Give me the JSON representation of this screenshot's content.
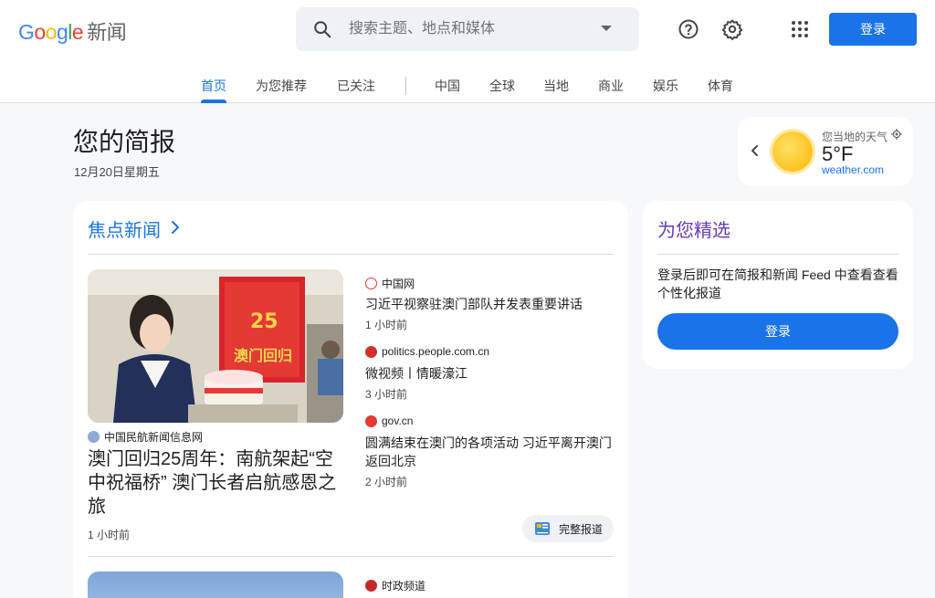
{
  "header": {
    "logo_google": [
      "G",
      "o",
      "o",
      "g",
      "l",
      "e"
    ],
    "logo_news": "新闻",
    "search_placeholder": "搜索主题、地点和媒体",
    "login_label": "登录"
  },
  "tabs": [
    {
      "label": "首页",
      "active": true
    },
    {
      "label": "为您推荐"
    },
    {
      "label": "已关注"
    },
    {
      "label": "中国"
    },
    {
      "label": "全球"
    },
    {
      "label": "当地"
    },
    {
      "label": "商业"
    },
    {
      "label": "娱乐"
    },
    {
      "label": "体育"
    }
  ],
  "briefing": {
    "title": "您的简报",
    "date": "12月20日星期五"
  },
  "weather": {
    "location_label": "您当地的天气",
    "temperature": "5°F",
    "source": "weather.com"
  },
  "top_stories": {
    "title": "焦点新闻",
    "hero": {
      "source": "中国民航新闻信息网",
      "title": "澳门回归25周年：南航架起“空中祝福桥” 澳门长者启航感恩之旅",
      "time": "1 小时前"
    },
    "articles": [
      {
        "source": "中国网",
        "title": "习近平视察驻澳门部队并发表重要讲话",
        "time": "1 小时前"
      },
      {
        "source": "politics.people.com.cn",
        "title": "微视频丨情暖濠江",
        "time": "3 小时前"
      },
      {
        "source": "gov.cn",
        "title": "圆满结束在澳门的各项活动 习近平离开澳门返回北京",
        "time": "2 小时前"
      }
    ],
    "full_coverage": "完整报道",
    "next_source": "时政频道"
  },
  "picks": {
    "title": "为您精选",
    "text": "登录后即可在简报和新闻 Feed 中查看查看个性化报道",
    "login_label": "登录"
  },
  "colors": {
    "accent": "#1a73e8",
    "picks_title": "#673ab7",
    "background": "#f6f8fc"
  }
}
